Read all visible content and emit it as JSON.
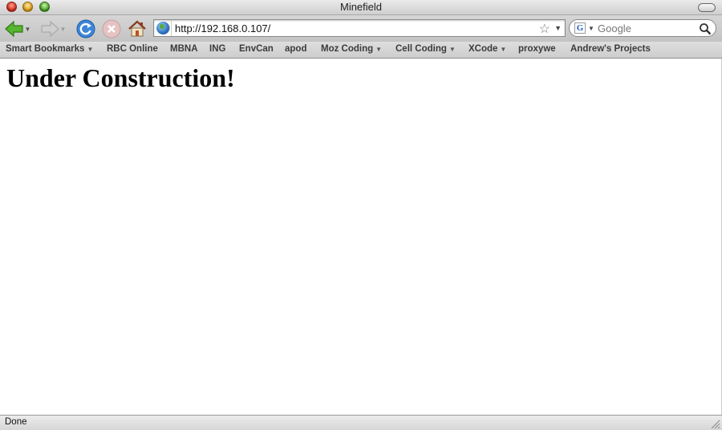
{
  "window": {
    "title": "Minefield"
  },
  "toolbar": {
    "url": "http://192.168.0.107/",
    "search_placeholder": "Google"
  },
  "bookmarks": [
    {
      "label": "Smart Bookmarks",
      "dropdown": true
    },
    {
      "label": "RBC Online",
      "dropdown": false
    },
    {
      "label": "MBNA",
      "dropdown": false
    },
    {
      "label": "ING",
      "dropdown": false
    },
    {
      "label": "EnvCan",
      "dropdown": false
    },
    {
      "label": "apod",
      "dropdown": false
    },
    {
      "label": "Moz Coding",
      "dropdown": true
    },
    {
      "label": "Cell Coding",
      "dropdown": true
    },
    {
      "label": "XCode",
      "dropdown": true
    },
    {
      "label": "proxywe",
      "dropdown": false
    },
    {
      "label": "Andrew's Projects",
      "dropdown": false
    }
  ],
  "page": {
    "heading": "Under Construction!"
  },
  "status": {
    "text": "Done"
  },
  "colors": {
    "accent": "#2a62c9",
    "back_arrow": "#4caf2a"
  }
}
